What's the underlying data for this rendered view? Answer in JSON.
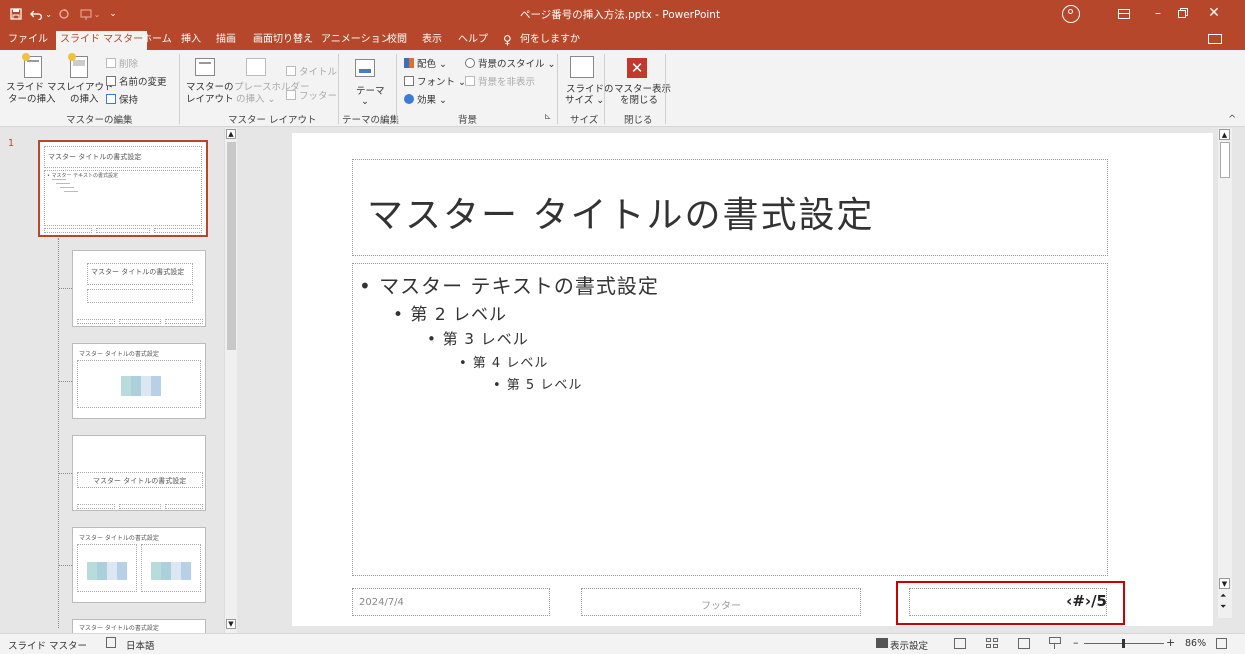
{
  "window": {
    "title": "ページ番号の挿入方法.pptx  -  PowerPoint",
    "colors": {
      "accent": "#b7472a",
      "ribbon_bg": "#f3f3f3",
      "highlight": "#cc0000"
    }
  },
  "quick_access": {
    "save_icon": "save-icon",
    "undo_icon": "undo-icon",
    "redo_icon": "redo-icon"
  },
  "tabs": [
    {
      "label": "ファイル"
    },
    {
      "label": "スライド マスター"
    },
    {
      "label": "ホーム"
    },
    {
      "label": "挿入"
    },
    {
      "label": "描画"
    },
    {
      "label": "画面切り替え"
    },
    {
      "label": "アニメーション"
    },
    {
      "label": "校閲"
    },
    {
      "label": "表示"
    },
    {
      "label": "ヘルプ"
    },
    {
      "label": "何をしますか"
    }
  ],
  "ribbon": {
    "insert_master_1": "スライド マス",
    "insert_master_2": "ターの挿入",
    "insert_layout_1": "レイアウト",
    "insert_layout_2": "の挿入",
    "delete": "削除",
    "rename": "名前の変更",
    "preserve": "保持",
    "group_edit_master": "マスターの編集",
    "master_layout_1": "マスターの",
    "master_layout_2": "レイアウト",
    "insert_placeholder_1": "プレースホルダー",
    "insert_placeholder_2": "の挿入 ⌄",
    "title_check": "タイトル",
    "footer_check": "フッター",
    "group_master_layout": "マスター レイアウト",
    "themes": "テーマ",
    "group_edit_theme": "テーマの編集",
    "colors": "配色 ⌄",
    "fonts": "フォント ⌄",
    "effects": "効果 ⌄",
    "bg_styles": "背景のスタイル ⌄",
    "hide_bg": "背景を非表示",
    "group_background": "背景",
    "slide_size_1": "スライドの",
    "slide_size_2": "サイズ ⌄",
    "group_size": "サイズ",
    "close_master_1": "マスター表示",
    "close_master_2": "を閉じる",
    "group_close": "閉じる"
  },
  "thumbnails": {
    "number": "1",
    "t1_title": "マスター タイトルの書式設定",
    "t1_body": "• マスター テキストの書式設定",
    "t2_title": "マスター タイトルの書式設定",
    "t3_title": "マスター タイトルの書式設定",
    "t4_title": "マスター タイトルの書式設定",
    "t5_title": "マスター タイトルの書式設定",
    "t6_title": "マスター タイトルの書式設定"
  },
  "slide": {
    "title": "マスター タイトルの書式設定",
    "levels": [
      "• マスター テキストの書式設定",
      "• 第 2 レベル",
      "• 第 3 レベル",
      "• 第 4 レベル",
      "• 第 5 レベル"
    ],
    "date": "2024/7/4",
    "footer": "フッター",
    "page_number": "‹#›/5"
  },
  "status": {
    "view": "スライド マスター",
    "language": "日本語",
    "display_settings": "表示設定",
    "zoom": "86%"
  }
}
